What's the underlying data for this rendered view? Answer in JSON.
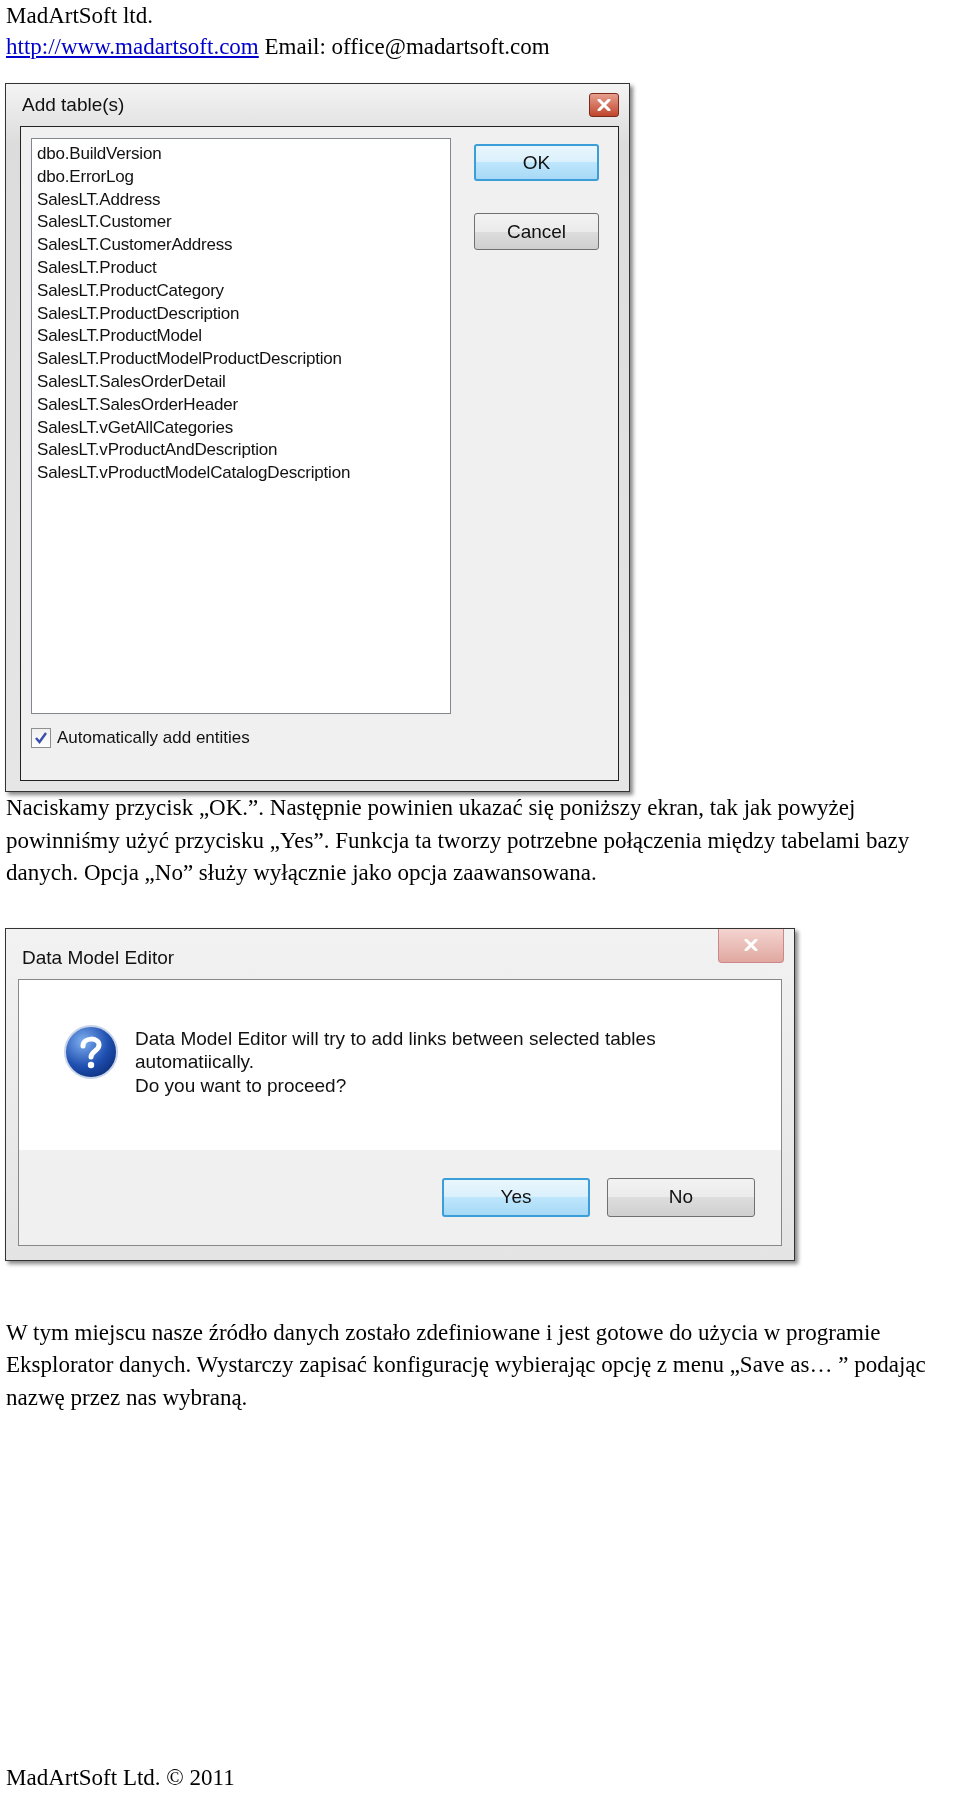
{
  "header": {
    "company": "MadArtSoft ltd.",
    "link": "http://www.madartsoft.com",
    "email": "Email: office@madartsoft.com"
  },
  "add_tables_dialog": {
    "title": "Add table(s)",
    "tables": [
      "dbo.BuildVersion",
      "dbo.ErrorLog",
      "SalesLT.Address",
      "SalesLT.Customer",
      "SalesLT.CustomerAddress",
      "SalesLT.Product",
      "SalesLT.ProductCategory",
      "SalesLT.ProductDescription",
      "SalesLT.ProductModel",
      "SalesLT.ProductModelProductDescription",
      "SalesLT.SalesOrderDetail",
      "SalesLT.SalesOrderHeader",
      "SalesLT.vGetAllCategories",
      "SalesLT.vProductAndDescription",
      "SalesLT.vProductModelCatalogDescription"
    ],
    "buttons": [
      {
        "label": "OK",
        "selected": true
      },
      {
        "label": "Cancel",
        "selected": false
      }
    ],
    "checkbox": {
      "label": "Automatically add entities",
      "checked": true
    }
  },
  "paragraph_1": "Naciskamy przycisk „OK.”. Następnie powinien ukazać się poniższy ekran, tak jak powyżej powinniśmy użyć przycisku „Yes”. Funkcja ta tworzy potrzebne połączenia między tabelami bazy danych. Opcja „No” służy wyłącznie jako opcja zaawansowana.",
  "confirm_dialog": {
    "title": "Data Model Editor",
    "message": [
      "Data Model Editor will try to add links between selected tables",
      "automatiically.",
      "Do you want to proceed?"
    ],
    "buttons": [
      {
        "label": "Yes",
        "selected": true
      },
      {
        "label": "No",
        "selected": false
      }
    ]
  },
  "paragraph_2": "W tym miejscu nasze źródło danych zostało zdefiniowane i jest gotowe do użycia w programie Eksplorator danych. Wystarczy zapisać konfigurację wybierając opcję z menu „Save as… ” podając nazwę przez nas wybraną.",
  "footer": "MadArtSoft Ltd. © 2011"
}
